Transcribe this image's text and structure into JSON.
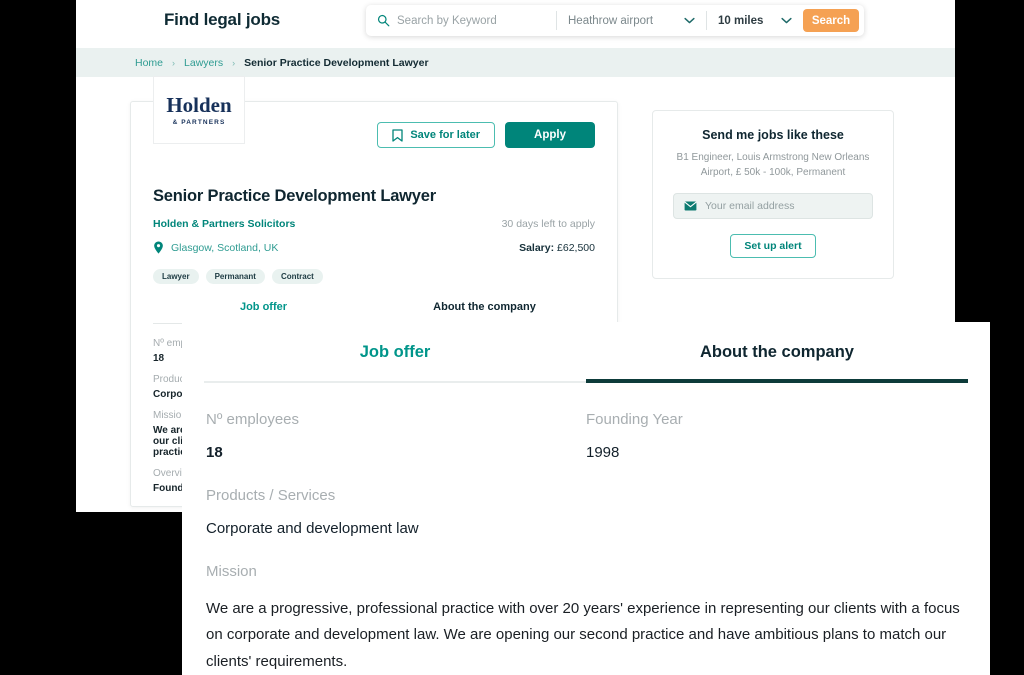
{
  "header": {
    "brand": "Find legal jobs",
    "search": {
      "keyword_placeholder": "Search by Keyword",
      "keyword_value": "",
      "location_value": "Heathrow airport",
      "radius_value": "10 miles",
      "search_button": "Search",
      "search_icon": "search-icon",
      "chevron_icon": "chevron-down-icon",
      "accent_color": "#f5a153"
    }
  },
  "breadcrumb": {
    "items": [
      {
        "label": "Home",
        "current": false
      },
      {
        "label": "Lawyers",
        "current": false
      },
      {
        "label": "Senior Practice Development Lawyer",
        "current": true
      }
    ],
    "separator": "›",
    "band_color": "#eaf1f0"
  },
  "job_card": {
    "logo": {
      "name": "Holden",
      "subtitle": "& PARTNERS",
      "color": "#17315a"
    },
    "save_button": {
      "label": "Save for later",
      "icon": "bookmark-icon"
    },
    "apply_button": {
      "label": "Apply",
      "color": "#00857a"
    },
    "title": "Senior Practice Development Lawyer",
    "company": "Holden & Partners Solicitors",
    "days_left": "30 days left to apply",
    "location": "Glasgow, Scotland, UK",
    "location_icon": "map-pin-icon",
    "salary_label": "Salary:",
    "salary_value": "£62,500",
    "chips": [
      "Lawyer",
      "Permanant",
      "Contract"
    ],
    "tabs": [
      {
        "label": "Job offer",
        "active": false
      },
      {
        "label": "About the company",
        "active": true
      }
    ],
    "details": [
      {
        "label": "Nº employees",
        "value": "18"
      },
      {
        "label": "Products / Services",
        "value": "Corporate and development law"
      },
      {
        "label": "Mission",
        "value": "We are a progressive, professional practice with over 20 years' experience in representing our clients with a focus on corporate and development law. We are opening our second practice and have ambitious plans to match our clients' requirements."
      },
      {
        "label": "Overview",
        "value": "Founded"
      }
    ]
  },
  "alert_card": {
    "title": "Send me jobs like these",
    "subtitle": "B1 Engineer, Louis Armstrong New Orleans Airport, £ 50k - 100k, Permanent",
    "email_placeholder": "Your email address",
    "email_value": "",
    "email_icon": "envelope-icon",
    "button_label": "Set up alert"
  },
  "overlay": {
    "tabs": [
      {
        "label": "Job offer",
        "active": false
      },
      {
        "label": "About the company",
        "active": true
      }
    ],
    "fields": {
      "employees_label": "Nº employees",
      "employees_value": "18",
      "founding_label": "Founding Year",
      "founding_value": "1998",
      "products_label": "Products / Services",
      "products_value": "Corporate and development law",
      "mission_label": "Mission",
      "mission_value": "We are a progressive, professional practice with over 20 years' experience in representing our clients with a focus on corporate and development law. We are opening our second practice and have ambitious plans to match our clients' requirements."
    }
  }
}
